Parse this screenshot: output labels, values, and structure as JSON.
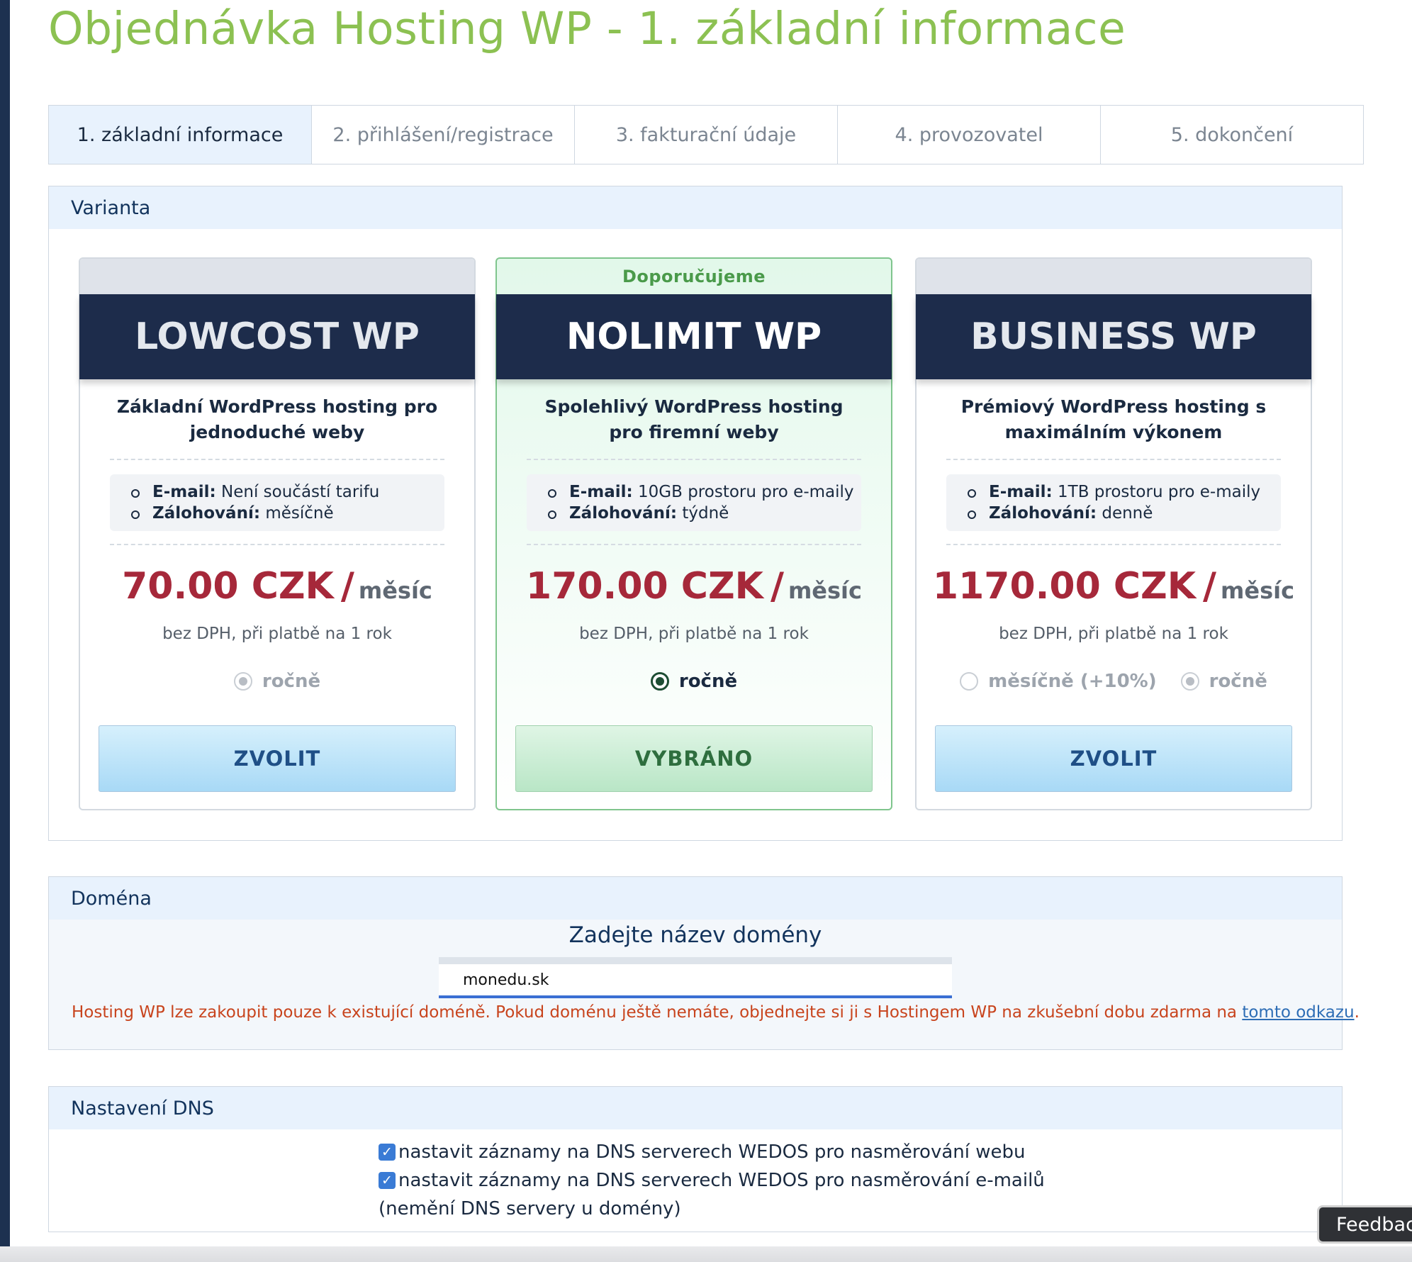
{
  "page": {
    "title": "Objednávka Hosting WP - 1. základní informace"
  },
  "steps": [
    {
      "label": "1. základní informace",
      "active": true
    },
    {
      "label": "2. přihlášení/registrace",
      "active": false
    },
    {
      "label": "3. fakturační údaje",
      "active": false
    },
    {
      "label": "4. provozovatel",
      "active": false
    },
    {
      "label": "5. dokončení",
      "active": false
    }
  ],
  "variant": {
    "header": "Varianta",
    "plans": [
      {
        "badge": "",
        "name": "LOWCOST WP",
        "description": "Základní WordPress hosting pro jednoduché weby",
        "features": [
          {
            "label": "E-mail:",
            "value": "Není součástí tarifu"
          },
          {
            "label": "Zálohování:",
            "value": "měsíčně"
          }
        ],
        "price": "70.00 CZK",
        "slash": "/",
        "per": "měsíc",
        "price_note": "bez DPH, při platbě na 1 rok",
        "periods": [
          {
            "label": "ročně",
            "selected": true
          }
        ],
        "button": "ZVOLIT",
        "recommended": false
      },
      {
        "badge": "Doporučujeme",
        "name": "NOLIMIT WP",
        "description": "Spolehlivý WordPress hosting pro firemní weby",
        "features": [
          {
            "label": "E-mail:",
            "value": "10GB prostoru pro e-maily"
          },
          {
            "label": "Zálohování:",
            "value": "týdně"
          }
        ],
        "price": "170.00 CZK",
        "slash": "/",
        "per": "měsíc",
        "price_note": "bez DPH, při platbě na 1 rok",
        "periods": [
          {
            "label": "ročně",
            "selected": true
          }
        ],
        "button": "VYBRÁNO",
        "recommended": true
      },
      {
        "badge": "",
        "name": "BUSINESS WP",
        "description": "Prémiový WordPress hosting s maximálním výkonem",
        "features": [
          {
            "label": "E-mail:",
            "value": "1TB prostoru pro e-maily"
          },
          {
            "label": "Zálohování:",
            "value": "denně"
          }
        ],
        "price": "1170.00 CZK",
        "slash": "/",
        "per": "měsíc",
        "price_note": "bez DPH, při platbě na 1 rok",
        "periods": [
          {
            "label": "měsíčně (+10%)",
            "selected": false
          },
          {
            "label": "ročně",
            "selected": true
          }
        ],
        "button": "ZVOLIT",
        "recommended": false
      }
    ]
  },
  "domain": {
    "header": "Doména",
    "label": "Zadejte název domény",
    "value": "monedu.sk",
    "note": "Hosting WP lze zakoupit pouze k existující doméně. Pokud doménu ještě nemáte, objednejte si ji s Hostingem WP na zkušební dobu zdarma na ",
    "link": "tomto odkazu",
    "note_end": "."
  },
  "dns": {
    "header": "Nastavení DNS",
    "options": [
      {
        "label": "nastavit záznamy na DNS serverech WEDOS pro nasměrování webu",
        "checked": true
      },
      {
        "label": "nastavit záznamy na DNS serverech WEDOS pro nasměrování e-mailů",
        "checked": true
      }
    ],
    "note": "(nemění DNS servery u domény)"
  },
  "feedback": {
    "label": "Feedback"
  }
}
